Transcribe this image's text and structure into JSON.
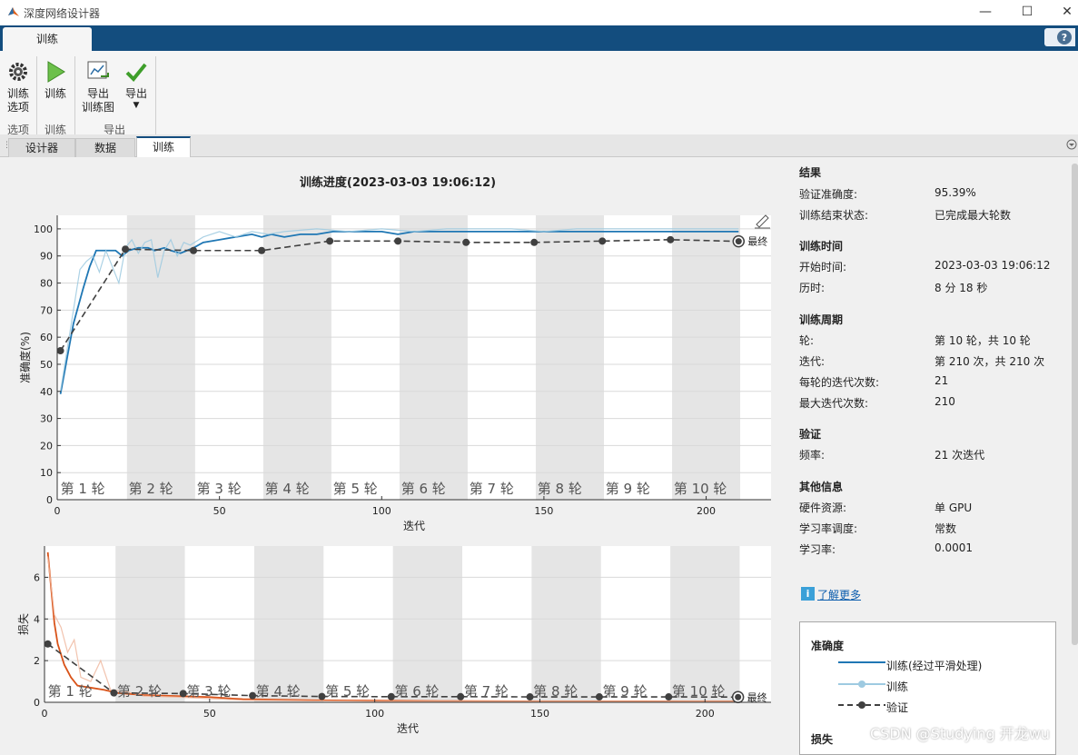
{
  "window": {
    "title": "深度网络设计器",
    "minimize_glyph": "—",
    "maximize_glyph": "☐",
    "close_glyph": "✕"
  },
  "ribbon": {
    "tab_label": "训练",
    "tools": {
      "train_options": "训练\n选项",
      "train": "训练",
      "export_plot": "导出\n训练图",
      "export": "导出"
    },
    "groups": {
      "options": "选项",
      "train": "训练",
      "export": "导出"
    }
  },
  "doc_tabs": [
    "设计器",
    "数据",
    "训练"
  ],
  "progress": {
    "title": "训练进度(2023-03-03 19:06:12)"
  },
  "results": {
    "section_result": "结果",
    "val_acc_label": "验证准确度:",
    "val_acc": "95.39%",
    "end_state_label": "训练结束状态:",
    "end_state": "已完成最大轮数",
    "section_time": "训练时间",
    "start_label": "开始时间:",
    "start": "2023-03-03 19:06:12",
    "elapsed_label": "历时:",
    "elapsed": "8 分 18 秒",
    "section_cycle": "训练周期",
    "epoch_label": "轮:",
    "epoch": "第 10 轮，共 10 轮",
    "iter_label": "迭代:",
    "iter": "第 210 次，共 210 次",
    "iter_per_epoch_label": "每轮的迭代次数:",
    "iter_per_epoch": "21",
    "max_iter_label": "最大迭代次数:",
    "max_iter": "210",
    "section_val": "验证",
    "freq_label": "频率:",
    "freq": "21 次迭代",
    "section_other": "其他信息",
    "hw_label": "硬件资源:",
    "hw": "单 GPU",
    "lr_sched_label": "学习率调度:",
    "lr_sched": "常数",
    "lr_label": "学习率:",
    "lr": "0.0001",
    "learn_more": "了解更多"
  },
  "legend": {
    "acc_title": "准确度",
    "smoothed": "训练(经过平滑处理)",
    "train": "训练",
    "validation": "验证",
    "loss_title": "损失"
  },
  "watermark": "CSDN @Studying 开龙wu",
  "chart_data": [
    {
      "type": "line",
      "title": "",
      "xlabel": "迭代",
      "ylabel": "准确度(%)",
      "xlim": [
        0,
        220
      ],
      "ylim": [
        0,
        105
      ],
      "xticks": [
        0,
        50,
        100,
        150,
        200
      ],
      "yticks": [
        0,
        10,
        20,
        30,
        40,
        50,
        60,
        70,
        80,
        90,
        100
      ],
      "epoch_labels": [
        "第 1 轮",
        "第 2 轮",
        "第 3 轮",
        "第 4 轮",
        "第 5 轮",
        "第 6 轮",
        "第 7 轮",
        "第 8 轮",
        "第 9 轮",
        "第 10 轮"
      ],
      "final_label": "最终",
      "series": [
        {
          "name": "训练(经过平滑处理)",
          "color": "#1f77b4",
          "x": [
            1,
            3,
            5,
            8,
            10,
            12,
            15,
            18,
            20,
            22,
            25,
            28,
            30,
            33,
            35,
            38,
            40,
            42,
            45,
            50,
            55,
            60,
            63,
            66,
            70,
            75,
            80,
            85,
            90,
            95,
            100,
            105,
            110,
            120,
            130,
            140,
            150,
            160,
            170,
            180,
            190,
            200,
            210
          ],
          "y": [
            39,
            52,
            65,
            78,
            86,
            92,
            92,
            92,
            90,
            92,
            93,
            93,
            92,
            93,
            92,
            91,
            92,
            93,
            95,
            96,
            97,
            98,
            97,
            98,
            97,
            98,
            98,
            99,
            99,
            99,
            99,
            98,
            99,
            99,
            99,
            99,
            99,
            99,
            99,
            99,
            99,
            99,
            99
          ]
        },
        {
          "name": "训练",
          "color": "#9ecae1",
          "x": [
            1,
            3,
            5,
            7,
            9,
            11,
            13,
            15,
            17,
            19,
            21,
            23,
            25,
            27,
            29,
            31,
            33,
            35,
            37,
            39,
            41,
            45,
            50,
            55,
            60,
            65,
            70,
            80,
            90,
            100,
            110,
            120,
            130,
            140,
            150,
            160,
            170,
            180,
            190,
            200,
            210
          ],
          "y": [
            40,
            55,
            70,
            85,
            88,
            90,
            84,
            92,
            86,
            80,
            93,
            96,
            91,
            95,
            96,
            82,
            92,
            96,
            90,
            95,
            94,
            97,
            99,
            97,
            99,
            98,
            99,
            100,
            99,
            100,
            99,
            100,
            100,
            100,
            99,
            100,
            100,
            100,
            100,
            100,
            100
          ]
        },
        {
          "name": "验证",
          "color": "#404040",
          "x": [
            1,
            21,
            42,
            63,
            84,
            105,
            126,
            147,
            168,
            189,
            210
          ],
          "y": [
            55,
            92.5,
            92,
            92,
            95.5,
            95.5,
            95,
            95,
            95.5,
            96,
            95.39
          ]
        }
      ]
    },
    {
      "type": "line",
      "title": "",
      "xlabel": "迭代",
      "ylabel": "损失",
      "xlim": [
        0,
        220
      ],
      "ylim": [
        0,
        7.5
      ],
      "xticks": [
        0,
        50,
        100,
        150,
        200
      ],
      "yticks": [
        0,
        2,
        4,
        6
      ],
      "epoch_labels": [
        "第 1 轮",
        "第 2 轮",
        "第 3 轮",
        "第 4 轮",
        "第 5 轮",
        "第 6 轮",
        "第 7 轮",
        "第 8 轮",
        "第 9 轮",
        "第 10 轮"
      ],
      "final_label": "最终",
      "series": [
        {
          "name": "训练(经过平滑处理)",
          "color": "#d95319",
          "x": [
            1,
            2,
            3,
            4,
            6,
            8,
            10,
            14,
            18,
            22,
            30,
            40,
            50,
            60,
            80,
            100,
            120,
            150,
            180,
            210
          ],
          "y": [
            7.2,
            5.5,
            3.8,
            2.8,
            1.8,
            1.2,
            0.8,
            0.7,
            0.6,
            0.45,
            0.35,
            0.3,
            0.25,
            0.15,
            0.1,
            0.08,
            0.06,
            0.05,
            0.05,
            0.04
          ]
        },
        {
          "name": "训练",
          "color": "#f0b8a0",
          "x": [
            1,
            3,
            5,
            7,
            9,
            11,
            14,
            17,
            20,
            25,
            30,
            40,
            60,
            100,
            150,
            210
          ],
          "y": [
            7.0,
            4.2,
            3.6,
            2.4,
            3.0,
            1.2,
            1.0,
            2.0,
            0.6,
            0.5,
            0.3,
            0.25,
            0.1,
            0.05,
            0.05,
            0.04
          ]
        },
        {
          "name": "验证",
          "color": "#404040",
          "x": [
            1,
            21,
            42,
            63,
            84,
            105,
            126,
            147,
            168,
            189,
            210
          ],
          "y": [
            2.8,
            0.45,
            0.42,
            0.32,
            0.28,
            0.27,
            0.27,
            0.26,
            0.26,
            0.26,
            0.25
          ]
        }
      ]
    }
  ]
}
